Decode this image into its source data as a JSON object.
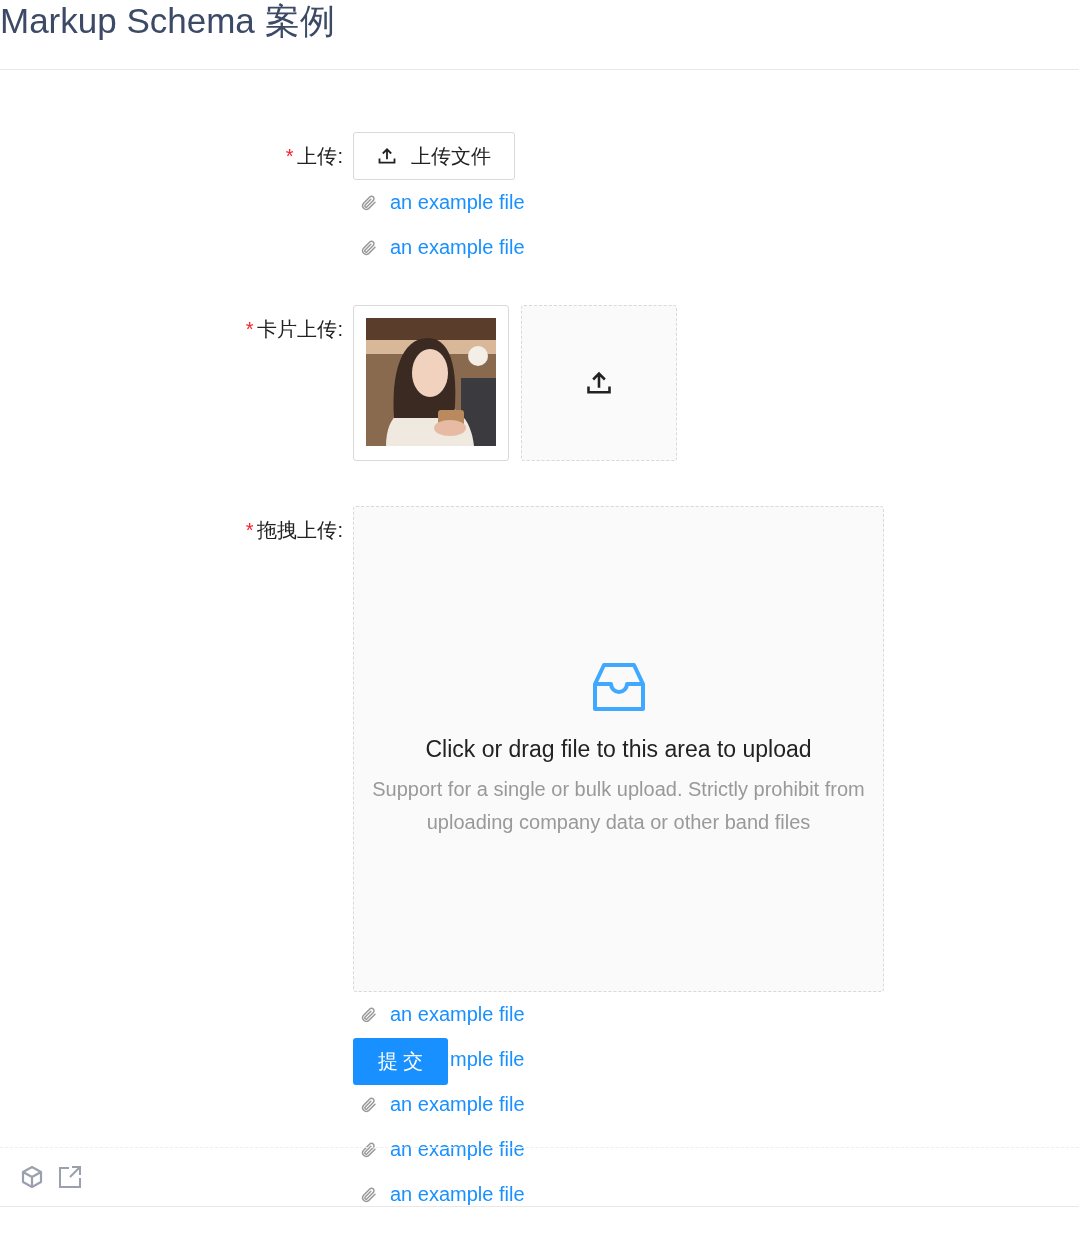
{
  "title": "Markup Schema 案例",
  "fields": [
    {
      "kind": "button-upload",
      "label": "上传:",
      "mark": "*",
      "button": "上传文件",
      "files": [
        {
          "name": "an example file",
          "covered": false
        },
        {
          "name": "an example file",
          "covered": false
        }
      ]
    },
    {
      "kind": "card-upload",
      "label": "卡片上传:",
      "mark": "*"
    },
    {
      "kind": "drag-upload",
      "label": "拖拽上传:",
      "mark": "*",
      "text": "Click or drag file to this area to upload",
      "hint": "Support for a single or bulk upload. Strictly prohibit from uploading company data or other band files",
      "files": [
        {
          "name": "an example file",
          "covered": false
        },
        {
          "name": "mple file",
          "covered": true
        },
        {
          "name": "an example file",
          "covered": false
        },
        {
          "name": "an example file",
          "covered": false
        },
        {
          "name": "an example file",
          "covered": false
        }
      ]
    }
  ],
  "submit": "提 交"
}
